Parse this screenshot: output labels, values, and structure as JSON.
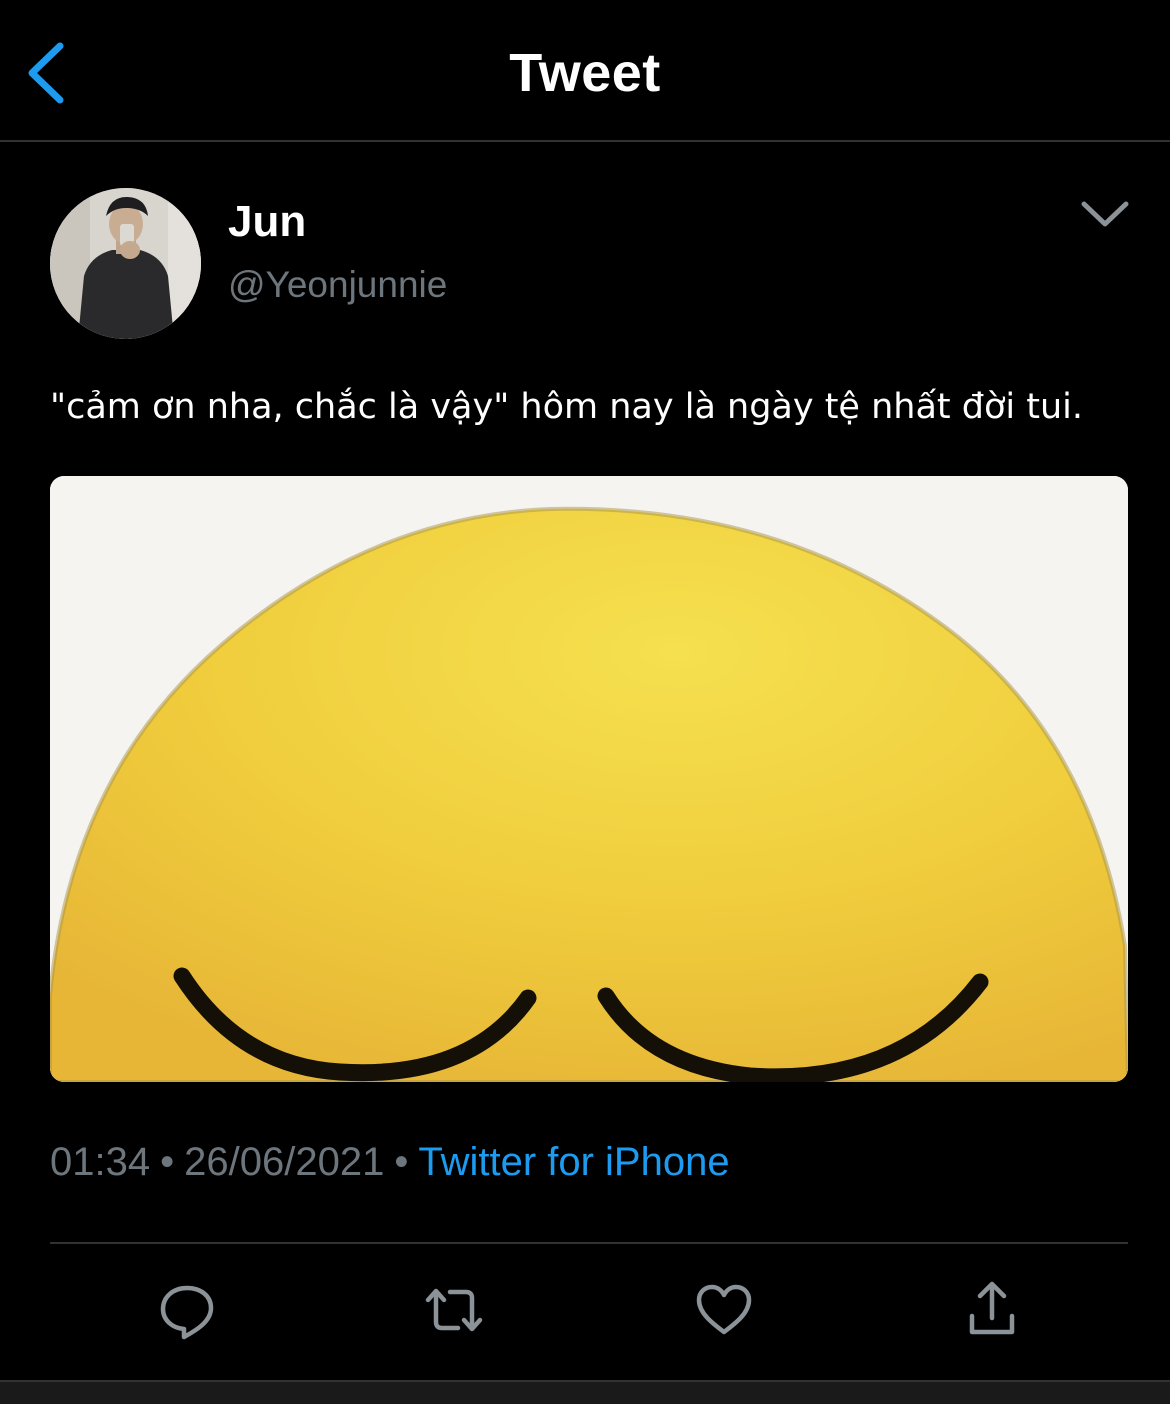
{
  "header": {
    "title": "Tweet",
    "back_icon": "chevron-left-icon"
  },
  "author": {
    "name": "Jun",
    "handle": "@Yeonjunnie"
  },
  "tweet": {
    "text": "\"cảm ơn nha, chắc là vậy\" hôm nay là ngày tệ nhất đời tui.",
    "media_description": "pensive face emoji"
  },
  "meta": {
    "time": "01:34",
    "separator": "•",
    "date": "26/06/2021",
    "source": "Twitter for iPhone"
  },
  "actions": [
    {
      "icon": "reply-icon"
    },
    {
      "icon": "retweet-icon"
    },
    {
      "icon": "like-icon"
    },
    {
      "icon": "share-icon"
    }
  ],
  "colors": {
    "background": "#000000",
    "accent": "#1d9bf0",
    "secondary_text": "#6e767d",
    "divider": "#2f3336",
    "emoji_yellow": "#f0c93c"
  }
}
